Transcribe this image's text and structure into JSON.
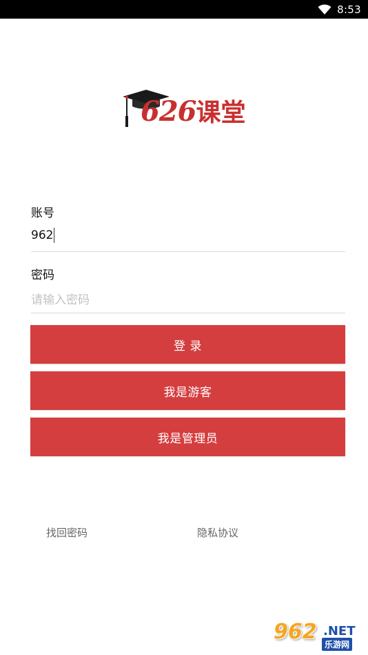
{
  "status_bar": {
    "time": "8:53"
  },
  "logo": {
    "number": "626",
    "name": "课堂"
  },
  "form": {
    "account_label": "账号",
    "account_value": "962",
    "password_label": "密码",
    "password_placeholder": "请输入密码"
  },
  "buttons": {
    "login": "登 录",
    "guest": "我是游客",
    "admin": "我是管理员"
  },
  "links": {
    "forgot_password": "找回密码",
    "privacy": "隐私协议"
  },
  "watermark": {
    "number": "962",
    "suffix": ".NET",
    "subtitle": "乐游网"
  },
  "colors": {
    "brand_red": "#d43e3f",
    "logo_red": "#c8302f"
  }
}
